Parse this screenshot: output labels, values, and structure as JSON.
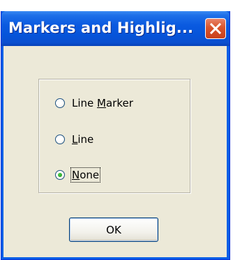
{
  "window": {
    "title": "Markers and Highlig...",
    "close_icon": "close-icon"
  },
  "options": [
    {
      "label_pre": "Line ",
      "label_ul": "M",
      "label_post": "arker",
      "checked": false
    },
    {
      "label_pre": "",
      "label_ul": "L",
      "label_post": "ine",
      "checked": false
    },
    {
      "label_pre": "",
      "label_ul": "N",
      "label_post": "one",
      "checked": true
    }
  ],
  "buttons": {
    "ok_label": "OK"
  },
  "colors": {
    "titlebar": "#0a5ae0",
    "close_button": "#d9542c",
    "client_background": "#ece9d8",
    "radio_dot": "#21a121"
  }
}
